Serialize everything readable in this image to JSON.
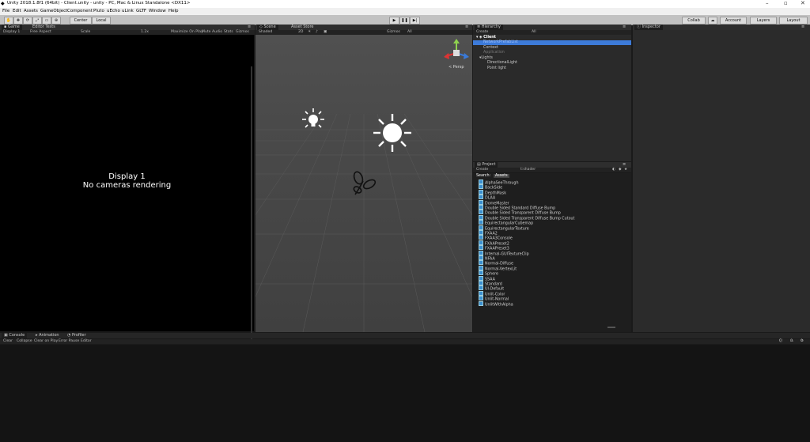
{
  "window": {
    "title": "Unity 2018.1.8f1 (64bit) - Client.unity - unity - PC, Mac & Linux Standalone <DX11>"
  },
  "menu": [
    "File",
    "Edit",
    "Assets",
    "GameObject",
    "Component",
    "Pluto",
    "uEcho",
    "uLink",
    "GLTF",
    "Window",
    "Help"
  ],
  "toolbar": {
    "center": "Center",
    "local": "Local",
    "collab": "Collab",
    "account": "Account",
    "layers": "Layers",
    "layout": "Layout"
  },
  "game": {
    "tabs": [
      "Game",
      "Editor Tests"
    ],
    "display": "Display 1",
    "aspect": "Free Aspect",
    "scale_label": "Scale",
    "scale_value": "1.2x",
    "maximize": "Maximize On Play",
    "mute": "Mute Audio",
    "stats": "Stats",
    "gizmos": "Gizmos",
    "message_line1": "Display 1",
    "message_line2": "No cameras rendering"
  },
  "scene": {
    "tabs": [
      "Scene",
      "Asset Store"
    ],
    "shading": "Shaded",
    "mode": "2D",
    "gizmos": "Gizmos",
    "search": "All",
    "persp": "< Persp"
  },
  "hierarchy": {
    "tab": "Hierarchy",
    "create": "Create",
    "search": "All",
    "root": "Client",
    "items": [
      "NetworkPrefabList",
      "Context",
      "Application",
      "Lights",
      "DirectionalLight",
      "Point light"
    ]
  },
  "project": {
    "tab": "Project",
    "create": "Create",
    "filter": "t:shader",
    "search_label": "Search:",
    "search_scope": "Assets",
    "assets": [
      "AlphaSeeThrough",
      "BackSide",
      "DepthMask",
      "DLAA",
      "DomeMaster",
      "Double Sided Standard Diffuse Bump",
      "Double Sided Transparent Diffuse Bump",
      "Double Sided Transparent Diffuse Bump Cutout",
      "EquirectangularCubemap",
      "EquirectangularTexture",
      "FXAA2",
      "FXAA3Console",
      "FXAAPreset2",
      "FXAAPreset3",
      "Internal-GUITextureClip",
      "NFAA",
      "Normal-Diffuse",
      "Normal-VertexLit",
      "Sphere",
      "SSAA",
      "Standard",
      "UI-Default",
      "Unlit-Color",
      "Unlit-Normal",
      "UnlitWithAlpha"
    ]
  },
  "inspector": {
    "tab": "Inspector"
  },
  "console": {
    "tabs": [
      "Console",
      "Animation",
      "Profiler"
    ],
    "buttons": [
      "Clear",
      "Collapse",
      "Clear on Play",
      "Error Pause",
      "Editor"
    ],
    "counts": [
      "0",
      "0",
      "0"
    ]
  },
  "colors": {
    "accent_selection": "#3d7bd9",
    "panel_dark": "#000000",
    "scene_grid": "#4a4a4a"
  }
}
